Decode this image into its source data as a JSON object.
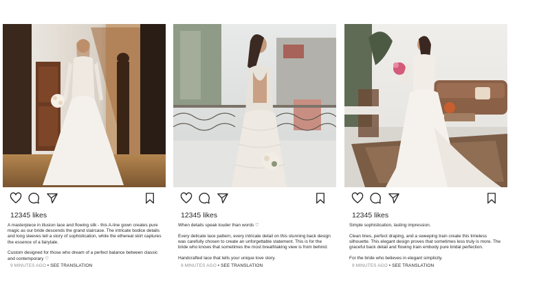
{
  "posts": [
    {
      "likes": "12345 likes",
      "caption": [
        "A masterpiece in illusion lace and flowing silk - this A-line gown creates pure magic as our bride descends the grand staircase. The intricate bodice details and long sleeves tell a story of sophistication, while the ethereal skirt captures the essence of a fairytale.",
        "Custom designed for those who dream of a perfect balance between classic and contemporary ♡"
      ],
      "timestamp": "9 MINUTES AGO",
      "separator": "•",
      "translation": "SEE TRANSLATION"
    },
    {
      "likes": "12345 likes",
      "caption": [
        "When details speak louder than words ♡",
        "Every delicate lace pattern, every intricate detail on this stunning back design was carefully chosen to create an unforgettable statement. This is for the bride who knows that sometimes the most breathtaking view is from behind.",
        "Handcrafted lace that tells your unique love story."
      ],
      "timestamp": "9 MINUTES AGO",
      "separator": "•",
      "translation": "SEE TRANSLATION"
    },
    {
      "likes": "12345 likes",
      "caption": [
        "Simple sophistication, lasting impression.",
        "Clean lines, perfect draping, and a sweeping train create this timeless silhouette. This elegant design proves that sometimes less truly is more. The graceful back detail and flowing train embody pure bridal perfection.",
        "For the bride who believes in elegant simplicity."
      ],
      "timestamp": "9 MINUTES AGO",
      "separator": "•",
      "translation": "SEE TRANSLATION"
    }
  ],
  "icons": {
    "like": "heart-icon",
    "comment": "comment-icon",
    "share": "paper-plane-icon",
    "save": "bookmark-icon"
  },
  "colors": {
    "text": "#262626",
    "muted": "#8e8e8e"
  }
}
